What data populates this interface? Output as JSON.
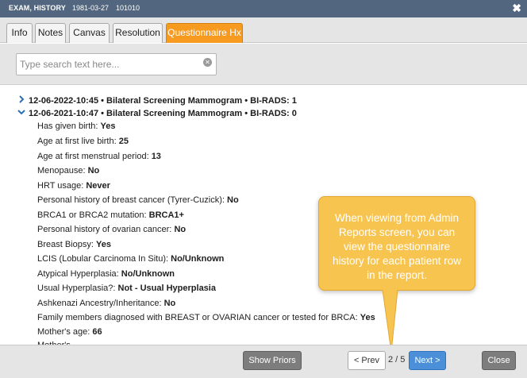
{
  "window": {
    "title": "EXAM, HISTORY",
    "dob": "1981-03-27",
    "patient_id": "101010",
    "close_glyph": "✖"
  },
  "tabs": [
    {
      "label": "Info",
      "active": false
    },
    {
      "label": "Notes",
      "active": false
    },
    {
      "label": "Canvas",
      "active": false
    },
    {
      "label": "Resolution",
      "active": false
    },
    {
      "label": "Questionnaire Hx",
      "active": true
    }
  ],
  "search": {
    "placeholder": "Type search text here...",
    "value": "",
    "clear_icon": "x-circle-icon"
  },
  "exams": [
    {
      "label": "12-06-2022-10:45 • Bilateral Screening Mammogram • BI-RADS: 1",
      "expanded": false,
      "icon": "chevron-right-icon",
      "glyph": "›"
    },
    {
      "label": "12-06-2021-10:47 • Bilateral Screening Mammogram • BI-RADS: 0",
      "expanded": true,
      "icon": "chevron-down-icon",
      "glyph": "⌄"
    }
  ],
  "questions": [
    {
      "q": "Has given birth:",
      "a": "Yes"
    },
    {
      "q": "Age at first live birth:",
      "a": "25"
    },
    {
      "q": "Age at first menstrual period:",
      "a": "13"
    },
    {
      "q": "Menopause:",
      "a": "No"
    },
    {
      "q": "HRT usage:",
      "a": "Never"
    },
    {
      "q": "Personal history of breast cancer (Tyrer-Cuzick):",
      "a": "No"
    },
    {
      "q": "BRCA1 or BRCA2 mutation:",
      "a": "BRCA1+"
    },
    {
      "q": "Personal history of ovarian cancer:",
      "a": "No"
    },
    {
      "q": "Breast Biopsy:",
      "a": "Yes"
    },
    {
      "q": "LCIS (Lobular Carcinoma In Situ):",
      "a": "No/Unknown"
    },
    {
      "q": "Atypical Hyperplasia:",
      "a": "No/Unknown"
    },
    {
      "q": "Usual Hyperplasia?:",
      "a": "Not - Usual Hyperplasia"
    },
    {
      "q": "Ashkenazi Ancestry/Inheritance:",
      "a": "No"
    },
    {
      "q": "Family members diagnosed with BREAST or OVARIAN cancer or tested for BRCA:",
      "a": "Yes"
    },
    {
      "q": "Mother's age:",
      "a": "66"
    }
  ],
  "callout": {
    "text": "When viewing from Admin Reports screen, you can view the questionnaire history for each patient row in the report."
  },
  "footer": {
    "show_priors": "Show Priors",
    "prev": "< Prev",
    "page_indicator": "2 / 5",
    "next": "Next >",
    "close": "Close"
  },
  "colors": {
    "titlebar": "#52677f",
    "active_tab": "#f79a20",
    "callout": "#f8c450",
    "next_button": "#4a8fd8",
    "chevron": "#2b6fb6"
  }
}
